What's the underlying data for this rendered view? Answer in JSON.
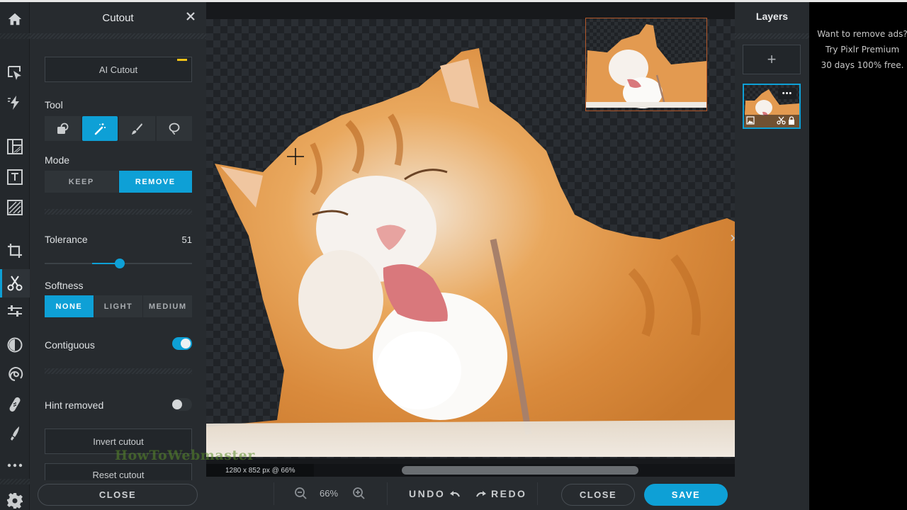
{
  "rail": {
    "items": [
      {
        "icon": "home-icon"
      },
      {
        "icon": "arrange-icon"
      },
      {
        "icon": "quick-fix-icon"
      },
      {
        "icon": "layout-icon"
      },
      {
        "icon": "text-icon"
      },
      {
        "icon": "pattern-icon"
      },
      {
        "icon": "crop-icon"
      },
      {
        "icon": "cutout-icon",
        "active": true
      },
      {
        "icon": "adjust-icon"
      },
      {
        "icon": "contrast-icon"
      },
      {
        "icon": "liquify-icon"
      },
      {
        "icon": "heal-icon"
      },
      {
        "icon": "brush-icon"
      },
      {
        "icon": "more-icon"
      },
      {
        "icon": "settings-icon"
      }
    ]
  },
  "panel": {
    "title": "Cutout",
    "ai_cutout_label": "AI Cutout",
    "tool_label": "Tool",
    "tools": [
      "fill-select",
      "magic-wand",
      "brush",
      "lasso"
    ],
    "active_tool": "magic-wand",
    "mode_label": "Mode",
    "mode_options": [
      "KEEP",
      "REMOVE"
    ],
    "mode_selected": "REMOVE",
    "tolerance_label": "Tolerance",
    "tolerance_value": "51",
    "tolerance_percent": 51,
    "softness_label": "Softness",
    "softness_options": [
      "NONE",
      "LIGHT",
      "MEDIUM"
    ],
    "softness_selected": "NONE",
    "contiguous_label": "Contiguous",
    "contiguous_on": true,
    "hint_removed_label": "Hint removed",
    "hint_removed_on": false,
    "invert_label": "Invert cutout",
    "reset_label": "Reset cutout",
    "close_label": "CLOSE"
  },
  "watermark": "HowToWebmaster",
  "canvas": {
    "dimensions_text": "1280 x 852 px @ 66%"
  },
  "bottombar": {
    "zoom_level": "66%",
    "undo_label": "UNDO",
    "redo_label": "REDO",
    "close_label": "CLOSE",
    "save_label": "SAVE"
  },
  "layers": {
    "title": "Layers",
    "add_label": "+",
    "more_label": "•••"
  },
  "ad": {
    "lines": [
      "Want to remove ads?",
      "Try Pixlr Premium",
      "30 days 100% free."
    ]
  },
  "colors": {
    "accent": "#0ea0d6",
    "panel_bg": "#272b2f",
    "rail_bg": "#24282c",
    "badge_yellow": "#f2c318",
    "navigator_border": "#b5592b"
  }
}
